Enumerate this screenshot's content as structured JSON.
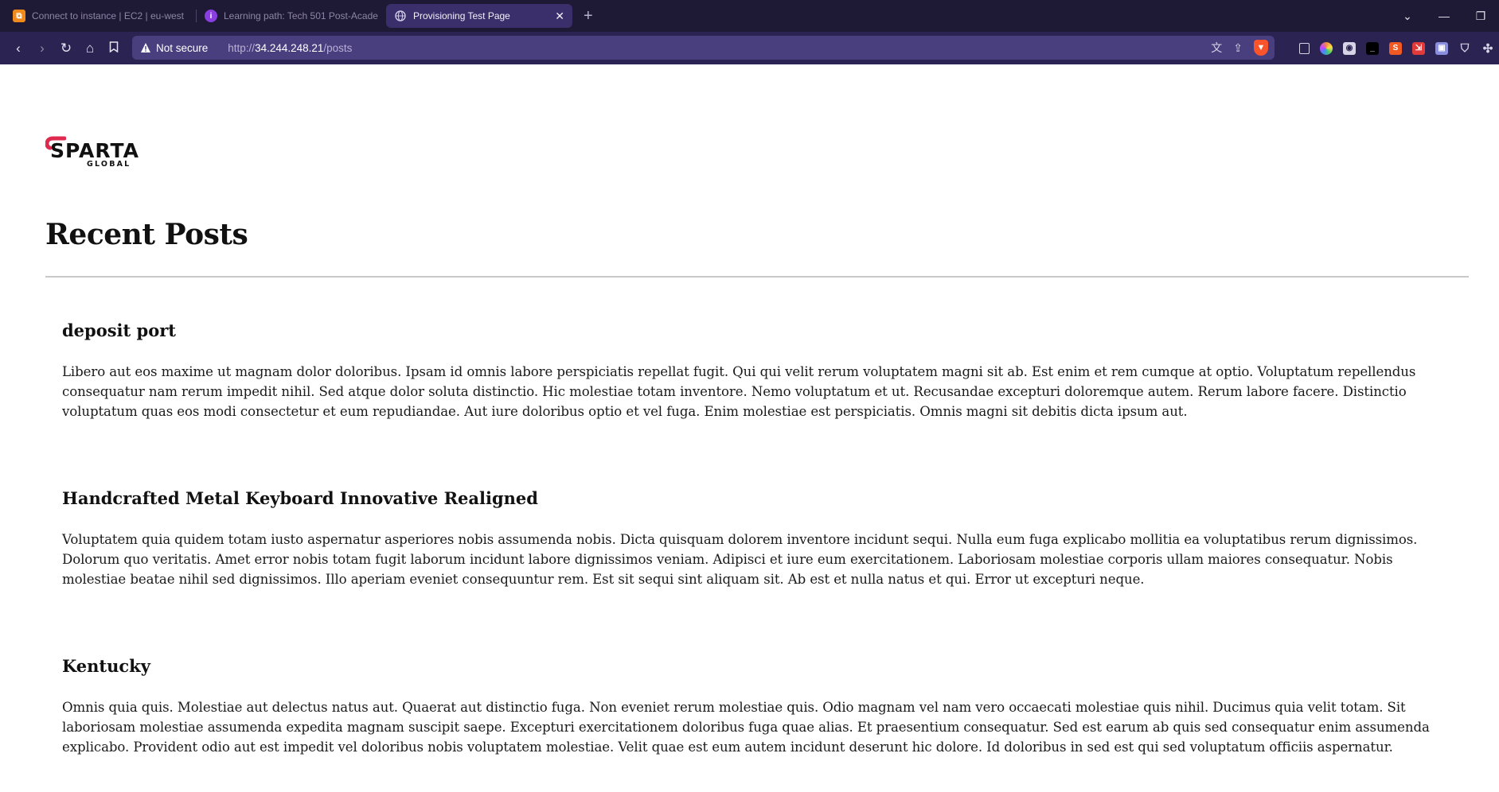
{
  "browser": {
    "tabs": [
      {
        "title": "Connect to instance | EC2 | eu-west",
        "icon": "aws-icon",
        "active": false
      },
      {
        "title": "Learning path: Tech 501 Post-Acade",
        "icon": "learning-icon",
        "active": false
      },
      {
        "title": "Provisioning Test Page",
        "icon": "globe-icon",
        "active": true
      }
    ],
    "security_label": "Not secure",
    "url_prefix": "http://",
    "url_host": "34.244.248.21",
    "url_path": "/posts"
  },
  "page": {
    "logo_main": "SPARTA",
    "logo_sub": "GLOBAL",
    "title": "Recent Posts",
    "posts": [
      {
        "title": "deposit port",
        "body": "Libero aut eos maxime ut magnam dolor doloribus. Ipsam id omnis labore perspiciatis repellat fugit. Qui qui velit rerum voluptatem magni sit ab. Est enim et rem cumque at optio. Voluptatum repellendus consequatur nam rerum impedit nihil. Sed atque dolor soluta distinctio. Hic molestiae totam inventore. Nemo voluptatum et ut. Recusandae excepturi doloremque autem. Rerum labore facere. Distinctio voluptatum quas eos modi consectetur et eum repudiandae. Aut iure doloribus optio et vel fuga. Enim molestiae est perspiciatis. Omnis magni sit debitis dicta ipsum aut."
      },
      {
        "title": "Handcrafted Metal Keyboard Innovative Realigned",
        "body": "Voluptatem quia quidem totam iusto aspernatur asperiores nobis assumenda nobis. Dicta quisquam dolorem inventore incidunt sequi. Nulla eum fuga explicabo mollitia ea voluptatibus rerum dignissimos. Dolorum quo veritatis. Amet error nobis totam fugit laborum incidunt labore dignissimos veniam. Adipisci et iure eum exercitationem. Laboriosam molestiae corporis ullam maiores consequatur. Nobis molestiae beatae nihil sed dignissimos. Illo aperiam eveniet consequuntur rem. Est sit sequi sint aliquam sit. Ab est et nulla natus et qui. Error ut excepturi neque."
      },
      {
        "title": "Kentucky",
        "body": "Omnis quia quis. Molestiae aut delectus natus aut. Quaerat aut distinctio fuga. Non eveniet rerum molestiae quis. Odio magnam vel nam vero occaecati molestiae quis nihil. Ducimus quia velit totam. Sit laboriosam molestiae assumenda expedita magnam suscipit saepe. Excepturi exercitationem doloribus fuga quae alias. Et praesentium consequatur. Sed est earum ab quis sed consequatur enim assumenda explicabo. Provident odio aut est impedit vel doloribus nobis voluptatem molestiae. Velit quae est eum autem incidunt deserunt hic dolore. Id doloribus in sed est qui sed voluptatum officiis aspernatur."
      }
    ]
  },
  "colors": {
    "tabbar": "#1e1934",
    "toolbar": "#2b2452",
    "urlbar": "#4a3f7e",
    "active_tab": "#3b2f6b",
    "logo_accent": "#e0294f"
  }
}
